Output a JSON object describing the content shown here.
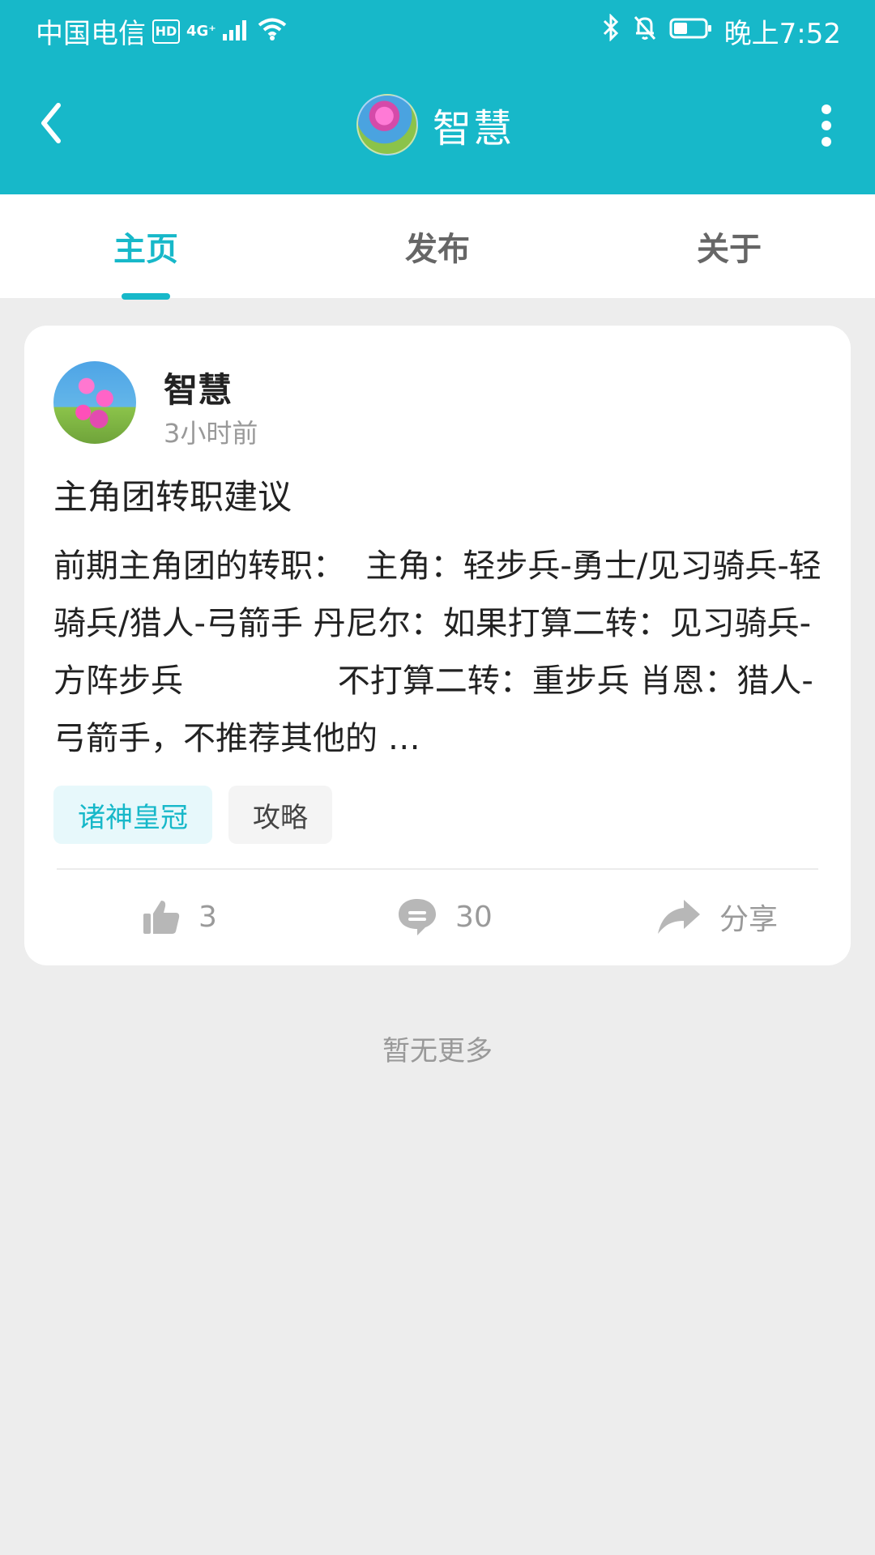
{
  "status_bar": {
    "carrier": "中国电信",
    "hd": "HD",
    "network": "4G⁺",
    "time": "晚上7:52"
  },
  "header": {
    "title": "智慧"
  },
  "tabs": [
    {
      "label": "主页"
    },
    {
      "label": "发布"
    },
    {
      "label": "关于"
    }
  ],
  "post": {
    "author": "智慧",
    "time": "3小时前",
    "title": "主角团转职建议",
    "excerpt": "前期主角团的转职：  主角：轻步兵-勇士/见习骑兵-轻骑兵/猎人-弓箭手 丹尼尔：如果打算二转：见习骑兵-方阵步兵               不打算二转：重步兵 肖恩：猎人-弓箭手，不推荐其他的 …",
    "tags": [
      "诸神皇冠",
      "攻略"
    ],
    "likes": "3",
    "comments": "30",
    "share_label": "分享"
  },
  "footer": {
    "note": "暂无更多"
  },
  "colors": {
    "primary": "#17b8c9",
    "background": "#ededed",
    "card": "#ffffff",
    "muted": "#999999"
  }
}
